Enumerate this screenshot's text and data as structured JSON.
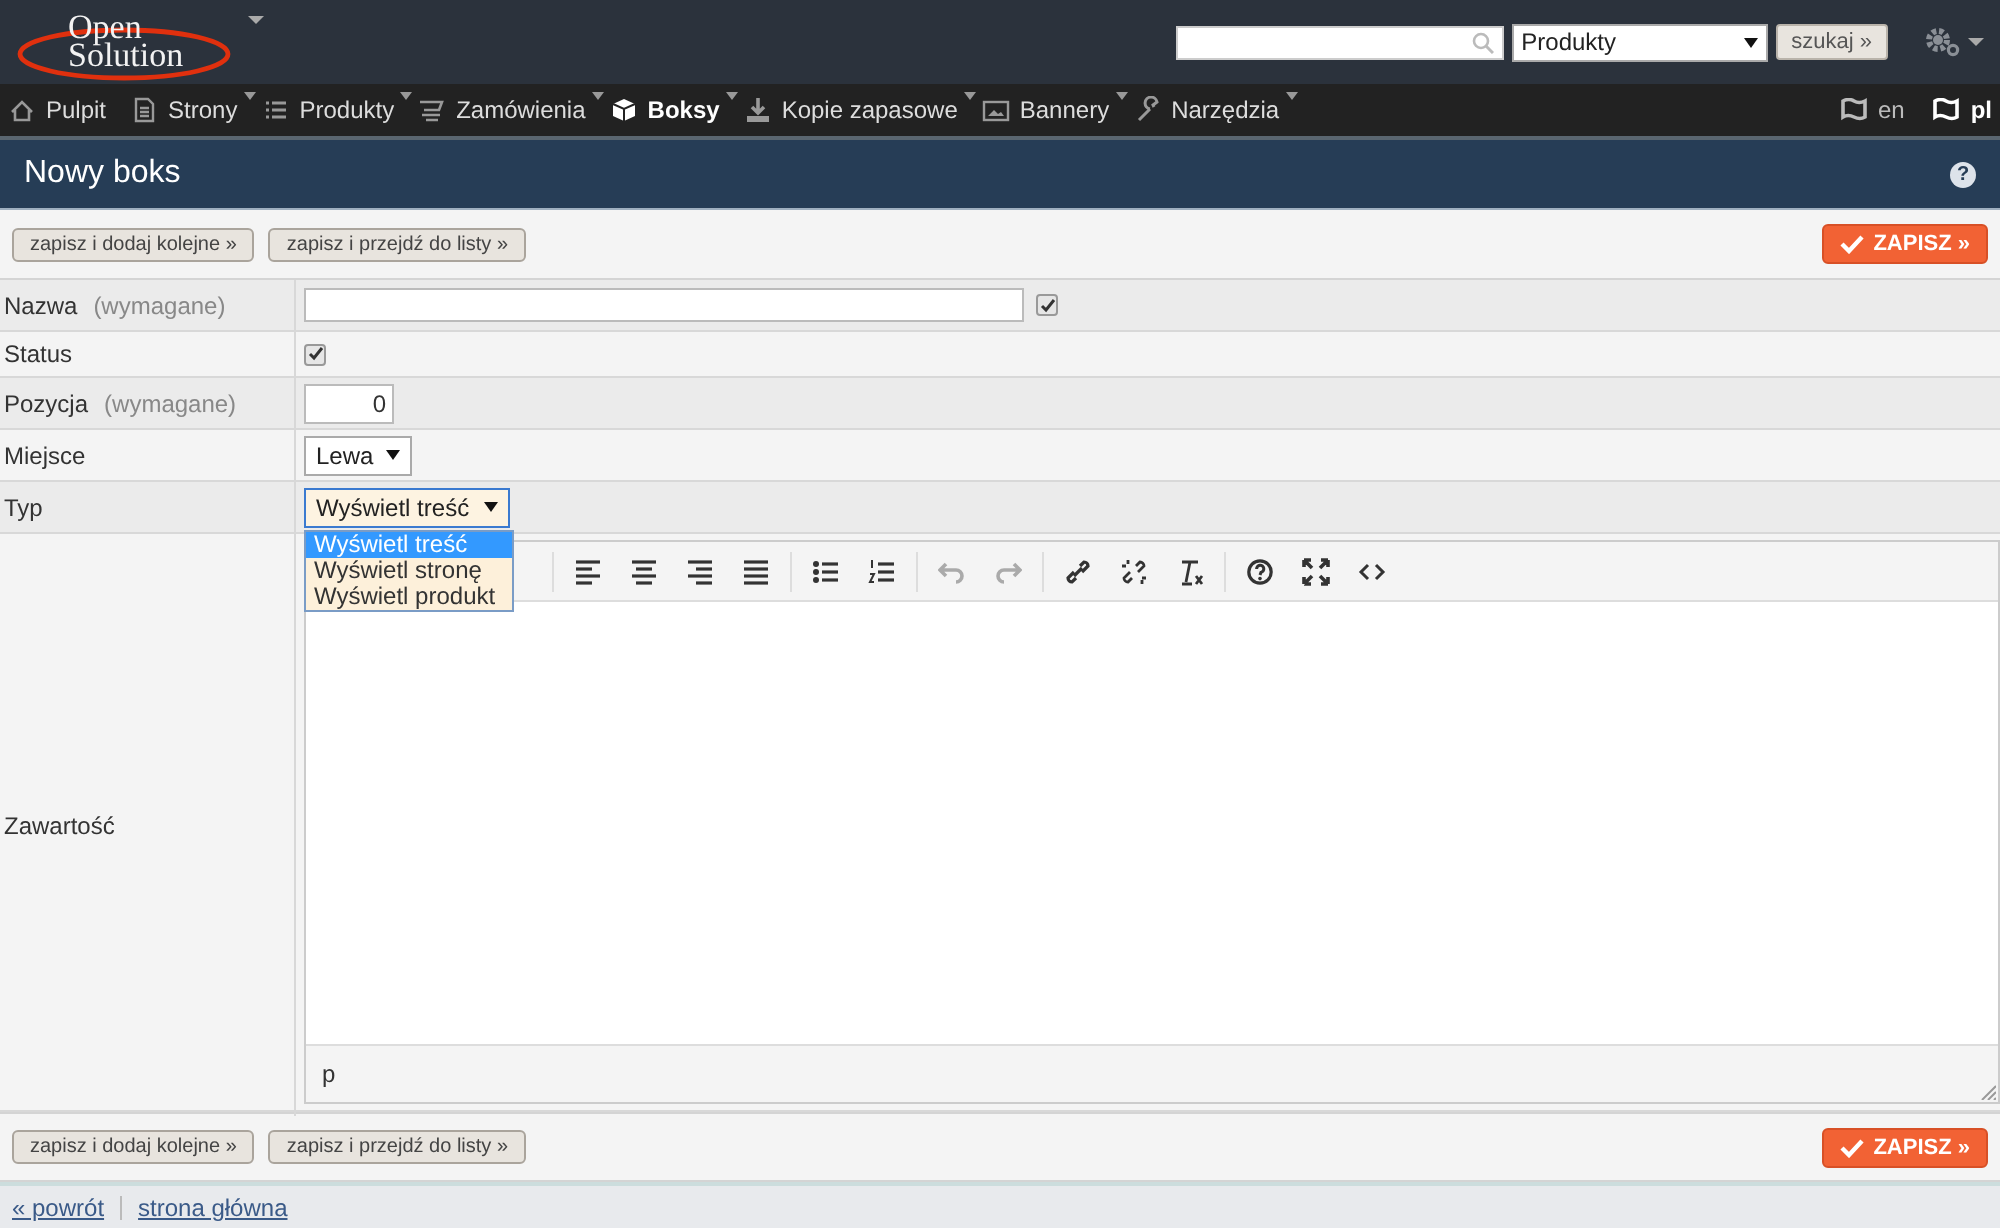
{
  "header": {
    "logo": {
      "line1": "Open",
      "line2": "Solution"
    },
    "search_scope": "Produkty",
    "search_button": "szukaj »"
  },
  "nav": {
    "items": [
      {
        "label": "Pulpit",
        "selected": false,
        "dropdown": false
      },
      {
        "label": "Strony",
        "selected": false,
        "dropdown": true
      },
      {
        "label": "Produkty",
        "selected": false,
        "dropdown": true
      },
      {
        "label": "Zamówienia",
        "selected": false,
        "dropdown": true
      },
      {
        "label": "Boksy",
        "selected": true,
        "dropdown": true
      },
      {
        "label": "Kopie zapasowe",
        "selected": false,
        "dropdown": true
      },
      {
        "label": "Bannery",
        "selected": false,
        "dropdown": true
      },
      {
        "label": "Narzędzia",
        "selected": false,
        "dropdown": true
      }
    ],
    "languages": [
      {
        "code": "en",
        "selected": false
      },
      {
        "code": "pl",
        "selected": true
      }
    ]
  },
  "page_title": "Nowy boks",
  "help": "?",
  "actions": {
    "buttons": [
      "zapisz i dodaj kolejne »",
      "zapisz i przejdź do listy »"
    ],
    "primary": "ZAPISZ »"
  },
  "form": {
    "fields": [
      {
        "kind": "text",
        "label": "Nazwa",
        "note": "(wymagane)",
        "checked": true
      },
      {
        "kind": "checkbox",
        "label": "Status",
        "checked": true
      },
      {
        "kind": "number",
        "label": "Pozycja",
        "note": "(wymagane)",
        "value": "0"
      },
      {
        "kind": "select",
        "label": "Miejsce",
        "value": "Lewa"
      },
      {
        "kind": "select",
        "label": "Typ",
        "value": "Wyświetl treść",
        "expanded": true,
        "options": [
          {
            "label": "Wyświetl treść",
            "selected": true
          },
          {
            "label": "Wyświetl stronę",
            "selected": false
          },
          {
            "label": "Wyświetl produkt",
            "selected": false
          }
        ]
      },
      {
        "kind": "editor",
        "label": "Zawartość",
        "path": "p"
      }
    ]
  },
  "bottom_actions": {
    "buttons": [
      "zapisz i dodaj kolejne »",
      "zapisz i przejdź do listy »"
    ],
    "primary": "ZAPISZ »"
  },
  "footer": {
    "links": [
      "« powrót",
      "strona główna"
    ]
  }
}
